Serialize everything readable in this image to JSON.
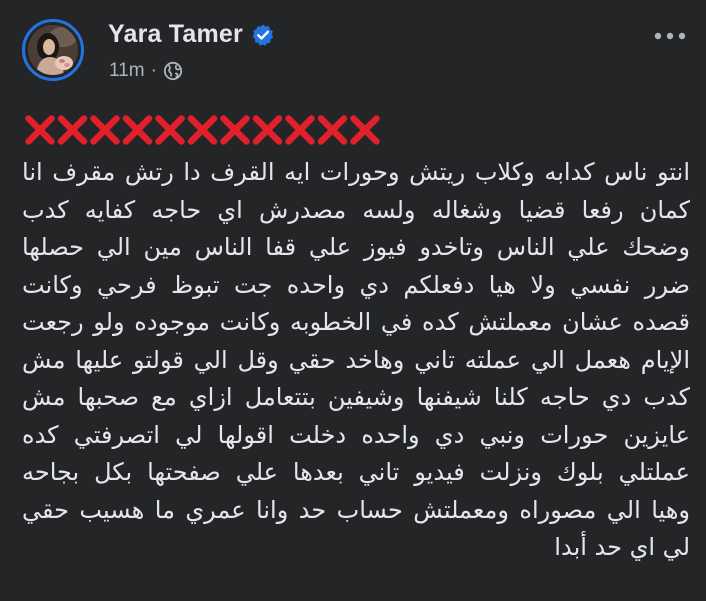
{
  "post": {
    "author": {
      "name": "Yara Tamer",
      "verified": true
    },
    "timestamp": "11m",
    "separator": "·",
    "privacy_icon": "globe-icon",
    "more_icon": "more-horizontal-icon",
    "emoji_line": "❌❌❌❌❌❌❌❌❌❌❌",
    "lines": [
      "انتو ناس كدابه وكلاب ريتش وحورات ايه القرف دا رتش مقرف انا",
      "كمان رفعا قضيا وشغاله ولسه مصدرش اي حاجه كفايه كدب",
      "وضحك علي الناس وتاخدو فيوز علي قفا الناس مين الي حصلها",
      "ضرر نفسي ولا هيا دفعلكم دي واحده جت تبوظ فرحي وكانت",
      "قصده عشان معملتش كده في الخطوبه وكانت موجوده ولو رجعت",
      "الإيام هعمل الي عملته تاني وهاخد حقي وقل الي قولتو عليها مش",
      "كدب دي حاجه كلنا شيفنها وشيفين بتتعامل ازاي مع صحبها مش",
      "عايزين حورات ونبي دي واحده دخلت اقولها لي اتصرفتي كده",
      "عملتلي بلوك ونزلت فيديو تاني بعدها علي صفحتها بكل بجاحه",
      "وهيا الي مصوراه ومعملتش حساب حد وانا عمري ما هسيب حقي",
      "لي اي حد أبدا"
    ]
  },
  "colors": {
    "background": "#242526",
    "primary_text": "#e4e6eb",
    "secondary_text": "#b0b3b8",
    "verified_blue": "#2374e1",
    "cross_red": "#e0202a"
  }
}
